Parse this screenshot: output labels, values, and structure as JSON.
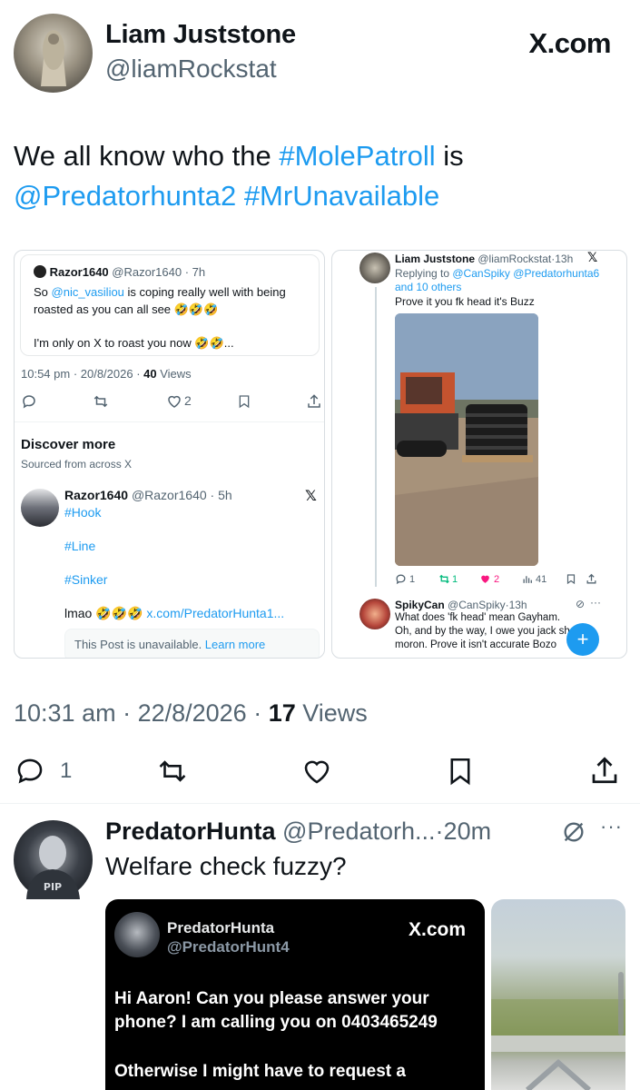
{
  "post": {
    "author_name": "Liam Juststone",
    "author_handle": "@liamRockstat",
    "brand": "X.com",
    "text_plain_1": "We all know who the ",
    "hashtag_1": "#MolePatroll",
    "text_plain_2": " is",
    "mention_1": "@Predatorhunta2",
    "hashtag_2": "#MrUnavailable",
    "time": "10:31 am",
    "date": "22/8/2026",
    "views_count": "17",
    "views_label": "Views",
    "reply_count": "1"
  },
  "left_card": {
    "quote_name": "Razor1640",
    "quote_handle": "@Razor1640",
    "quote_age": "7h",
    "quote_text_so": "So ",
    "quote_mention": "@nic_vasiliou",
    "quote_text_1": " is coping really well with being roasted as you can all see 🤣🤣🤣",
    "quote_text_2": "I'm only on X to roast you now 🤣🤣...",
    "meta_time": "10:54 pm · 20/8/2026 · ",
    "meta_views_count": "40",
    "meta_views_label": " Views",
    "like_count": "2",
    "discover_title": "Discover more",
    "discover_sub": "Sourced from across X",
    "rec_name": "Razor1640",
    "rec_handle": "@Razor1640",
    "rec_age": "5h",
    "rec_tag1": "#Hook",
    "rec_tag2": "#Line",
    "rec_tag3": "#Sinker",
    "rec_text": "lmao 🤣🤣🤣 ",
    "rec_link": "x.com/PredatorHunta1...",
    "unavailable_text": "This Post is unavailable. ",
    "learn_more": "Learn more"
  },
  "right_card": {
    "name": "Liam Juststone",
    "handle": "@liamRockstat",
    "age": "13h",
    "replying_label": "Replying to ",
    "replying_1": "@CanSpiky",
    "replying_2": "@Predatorhunta6",
    "replying_others": "and 10 others",
    "text": "Prove it you fk head it's Buzz",
    "reply_count": "1",
    "retweet_count": "1",
    "like_count": "2",
    "views_count": "41",
    "reply_name": "SpikyCan",
    "reply_handle": "@CanSpiky",
    "reply_age": "13h",
    "reply_text": "What does 'fk head' mean Gayham. Oh, and by the way, I owe you jack sh moron. Prove it isn't accurate Bozo"
  },
  "reply": {
    "name": "PredatorHunta",
    "handle": "@Predatorh...",
    "age": "20m",
    "text": "Welfare check fuzzy?",
    "media_name": "PredatorHunta",
    "media_handle": "@PredatorHunt4",
    "media_brand": "X.com",
    "media_text_1": "Hi Aaron! Can you please answer your phone? I am calling you on 0403465249",
    "media_text_2": "Otherwise I might have to request a"
  },
  "colors": {
    "link": "#1d9bf0",
    "secondary": "#536471",
    "text": "#0f1419",
    "like": "#f91880",
    "retweet": "#00ba7c"
  },
  "icons": [
    "reply-icon",
    "retweet-icon",
    "like-icon",
    "bookmark-icon",
    "share-icon",
    "grok-icon",
    "more-icon"
  ]
}
